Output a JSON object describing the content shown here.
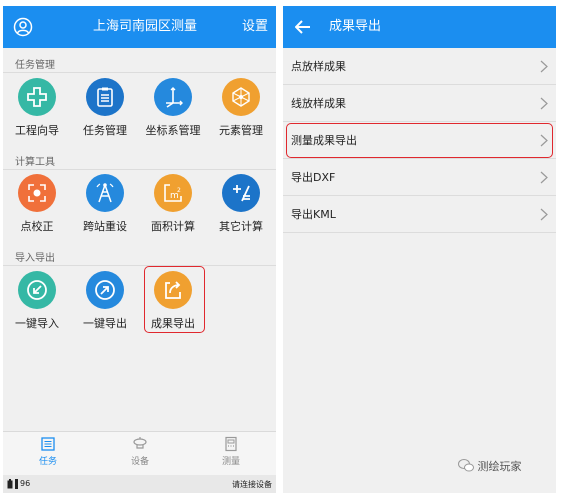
{
  "left": {
    "header": {
      "title": "上海司南园区测量",
      "settings_label": "设置"
    },
    "sections": [
      {
        "title": "任务管理",
        "items": [
          {
            "label": "工程向导",
            "icon": "plus-icon",
            "color": "#35b8a5"
          },
          {
            "label": "任务管理",
            "icon": "clipboard-icon",
            "color": "#1c74c9"
          },
          {
            "label": "坐标系管理",
            "icon": "axis-icon",
            "color": "#2589dd"
          },
          {
            "label": "元素管理",
            "icon": "network-icon",
            "color": "#f0a030"
          }
        ]
      },
      {
        "title": "计算工具",
        "items": [
          {
            "label": "点校正",
            "icon": "target-icon",
            "color": "#f0703a"
          },
          {
            "label": "跨站重设",
            "icon": "tower-icon",
            "color": "#2589dd"
          },
          {
            "label": "面积计算",
            "icon": "area-icon",
            "color": "#f0a030"
          },
          {
            "label": "其它计算",
            "icon": "calculator-icon",
            "color": "#1c74c9"
          }
        ]
      },
      {
        "title": "导入导出",
        "items": [
          {
            "label": "一键导入",
            "icon": "import-icon",
            "color": "#35b8a5"
          },
          {
            "label": "一键导出",
            "icon": "export-icon",
            "color": "#2589dd"
          },
          {
            "label": "成果导出",
            "icon": "result-export-icon",
            "color": "#f0a030"
          }
        ]
      }
    ],
    "bottom_nav": {
      "task": "任务",
      "device": "设备",
      "survey": "测量"
    },
    "status": {
      "battery": "96",
      "connect": "请连接设备"
    }
  },
  "right": {
    "header": {
      "title": "成果导出"
    },
    "items": [
      "点放样成果",
      "线放样成果",
      "测量成果导出",
      "导出DXF",
      "导出KML"
    ]
  },
  "watermark": "测绘玩家",
  "colors": {
    "primary": "#1b8ef0",
    "highlight": "#e0282e",
    "nav_active": "#1b8ef0"
  }
}
